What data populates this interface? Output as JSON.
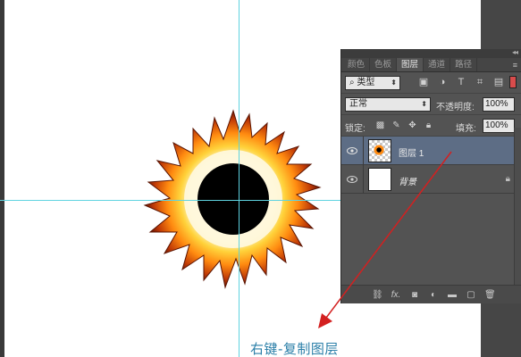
{
  "panel": {
    "tabs": [
      "颜色",
      "色板",
      "图层",
      "通道",
      "路径"
    ],
    "active_tab": "图层",
    "filter": {
      "selected": "类型"
    },
    "blend_mode": {
      "selected": "正常"
    },
    "opacity": {
      "label": "不透明度:",
      "value": "100%"
    },
    "lock": {
      "label": "锁定:"
    },
    "fill": {
      "label": "填充:",
      "value": "100%"
    },
    "layers": [
      {
        "name": "图层 1",
        "selected": true
      },
      {
        "name": "背景",
        "selected": false,
        "locked": true
      }
    ]
  },
  "annotation": {
    "caption": "右键-复制图层",
    "color": "#2b7fa8",
    "arrow_color": "#d32020"
  },
  "colors": {
    "panel_bg": "#535353",
    "selected_layer": "#5d6d85",
    "guide": "#5fd3e0"
  }
}
